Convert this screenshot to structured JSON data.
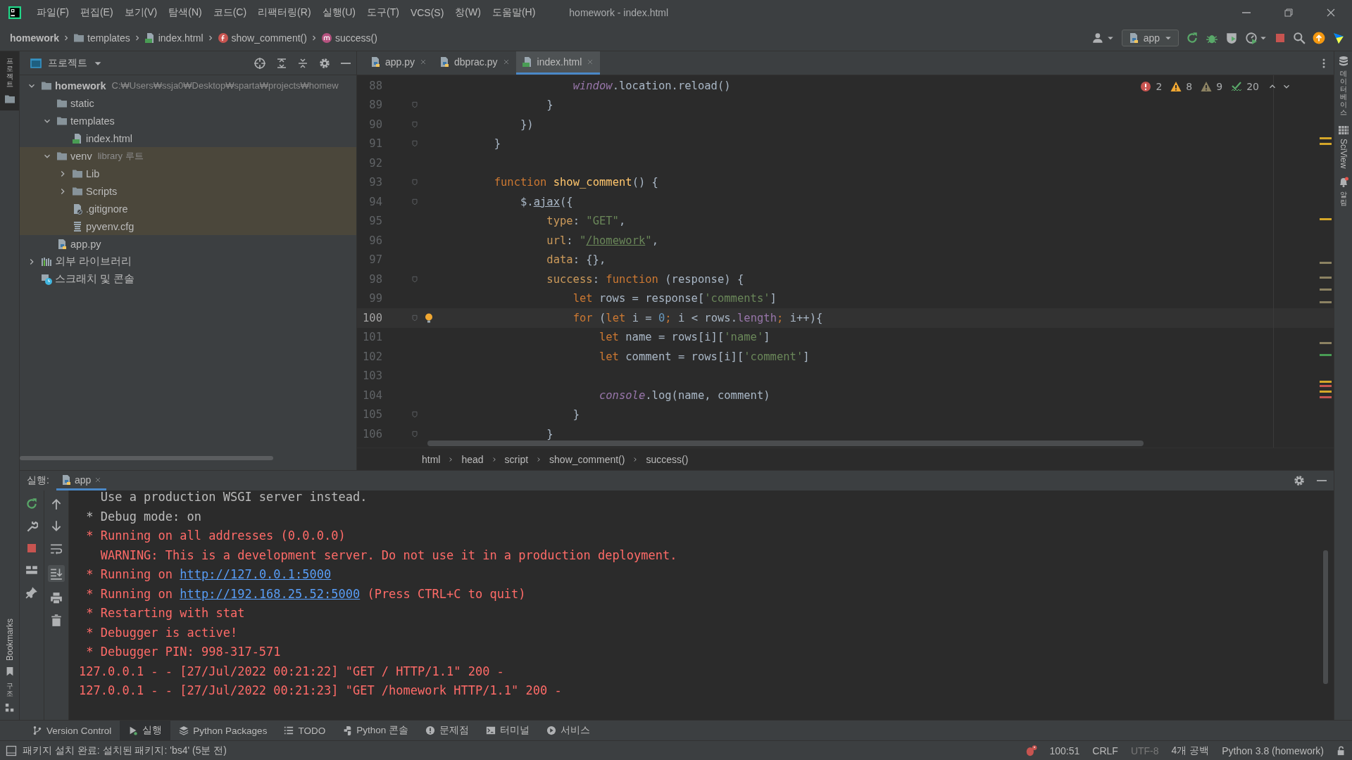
{
  "menu_bar": {
    "items": [
      "파일(F)",
      "편집(E)",
      "보기(V)",
      "탐색(N)",
      "코드(C)",
      "리팩터링(R)",
      "실행(U)",
      "도구(T)",
      "VCS(S)",
      "창(W)",
      "도움말(H)"
    ],
    "title": "homework - index.html"
  },
  "nav_bar": {
    "breadcrumbs": [
      {
        "kind": "project",
        "label": "homework"
      },
      {
        "kind": "folder",
        "label": "templates"
      },
      {
        "kind": "html",
        "label": "index.html"
      },
      {
        "kind": "function",
        "label": "show_comment()"
      },
      {
        "kind": "method",
        "label": "success()"
      }
    ],
    "run_config": "app"
  },
  "left_strip": {
    "project": "프로젝트",
    "bookmarks": "Bookmarks",
    "structure": "구조"
  },
  "project_panel": {
    "title": "프로젝트",
    "tree": [
      {
        "label": "homework",
        "kind": "project",
        "hint": "C:₩Users₩ssja0₩Desktop₩sparta₩projects₩homew",
        "expanded": true,
        "children": [
          {
            "label": "static",
            "kind": "folder"
          },
          {
            "label": "templates",
            "kind": "folder",
            "expanded": true,
            "children": [
              {
                "label": "index.html",
                "kind": "html"
              }
            ]
          },
          {
            "label": "venv",
            "kind": "folder",
            "hint": "library 루트",
            "expanded": true,
            "highlighted": true,
            "children": [
              {
                "label": "Lib",
                "kind": "folder",
                "expanded": false
              },
              {
                "label": "Scripts",
                "kind": "folder",
                "expanded": false
              },
              {
                "label": ".gitignore",
                "kind": "ignore"
              },
              {
                "label": "pyvenv.cfg",
                "kind": "config"
              }
            ]
          },
          {
            "label": "app.py",
            "kind": "python"
          }
        ]
      },
      {
        "label": "외부 라이브러리",
        "kind": "library",
        "expanded": false
      },
      {
        "label": "스크래치 및 콘솔",
        "kind": "scratch"
      }
    ]
  },
  "editor": {
    "tabs": [
      {
        "label": "app.py",
        "kind": "python",
        "selected": false
      },
      {
        "label": "dbprac.py",
        "kind": "python",
        "selected": false
      },
      {
        "label": "index.html",
        "kind": "html",
        "selected": true
      }
    ],
    "inspections": {
      "errors": "2",
      "warnings": "8",
      "weak_warnings": "9",
      "typos": "20"
    },
    "lines": [
      {
        "number": "88",
        "current": false,
        "fold": false,
        "segments": [
          {
            "kind": "global",
            "text": "                    window"
          },
          {
            "kind": "plain",
            "text": ".location.reload()"
          }
        ]
      },
      {
        "number": "89",
        "current": false,
        "fold": true,
        "segments": [
          {
            "kind": "plain",
            "text": "                }"
          }
        ]
      },
      {
        "number": "90",
        "current": false,
        "fold": true,
        "segments": [
          {
            "kind": "plain",
            "text": "            })"
          }
        ]
      },
      {
        "number": "91",
        "current": false,
        "fold": true,
        "segments": [
          {
            "kind": "plain",
            "text": "        }"
          }
        ]
      },
      {
        "number": "92",
        "current": false,
        "fold": false
      },
      {
        "number": "93",
        "current": false,
        "fold": true,
        "segments": [
          {
            "kind": "keyword",
            "text": "        function "
          },
          {
            "kind": "function",
            "text": "show_comment"
          },
          {
            "kind": "plain",
            "text": "() {"
          }
        ]
      },
      {
        "number": "94",
        "current": false,
        "fold": true,
        "segments": [
          {
            "kind": "plain",
            "text": "            $."
          },
          {
            "kind": "underlined",
            "text": "ajax"
          },
          {
            "kind": "plain",
            "text": "({"
          }
        ]
      },
      {
        "number": "95",
        "current": false,
        "fold": false,
        "segments": [
          {
            "kind": "key",
            "text": "                type"
          },
          {
            "kind": "plain",
            "text": ": "
          },
          {
            "kind": "string",
            "text": "\"GET\""
          },
          {
            "kind": "plain",
            "text": ","
          }
        ]
      },
      {
        "number": "96",
        "current": false,
        "fold": false,
        "segments": [
          {
            "kind": "key",
            "text": "                url"
          },
          {
            "kind": "plain",
            "text": ": "
          },
          {
            "kind": "string",
            "text": "\""
          },
          {
            "kind": "link",
            "text": "/homework"
          },
          {
            "kind": "string",
            "text": "\""
          },
          {
            "kind": "plain",
            "text": ","
          }
        ]
      },
      {
        "number": "97",
        "current": false,
        "fold": false,
        "segments": [
          {
            "kind": "key",
            "text": "                data"
          },
          {
            "kind": "plain",
            "text": ": {},"
          }
        ]
      },
      {
        "number": "98",
        "current": false,
        "fold": true,
        "segments": [
          {
            "kind": "key",
            "text": "                success"
          },
          {
            "kind": "plain",
            "text": ": "
          },
          {
            "kind": "keyword",
            "text": "function"
          },
          {
            "kind": "plain",
            "text": " (response) {"
          }
        ]
      },
      {
        "number": "99",
        "current": false,
        "fold": false,
        "segments": [
          {
            "kind": "keyword",
            "text": "                    let"
          },
          {
            "kind": "plain",
            "text": " rows = response["
          },
          {
            "kind": "string",
            "text": "'comments'"
          },
          {
            "kind": "plain",
            "text": "]"
          }
        ]
      },
      {
        "number": "100",
        "current": true,
        "fold": true,
        "segments": [
          {
            "kind": "keyword",
            "text": "                    for"
          },
          {
            "kind": "plain",
            "text": " ("
          },
          {
            "kind": "keyword",
            "text": "let"
          },
          {
            "kind": "plain",
            "text": " i = "
          },
          {
            "kind": "number",
            "text": "0"
          },
          {
            "kind": "keyword",
            "text": ";"
          },
          {
            "kind": "plain",
            "text": " i < rows."
          },
          {
            "kind": "property",
            "text": "length"
          },
          {
            "kind": "keyword",
            "text": ";"
          },
          {
            "kind": "plain",
            "text": " i++){"
          }
        ]
      },
      {
        "number": "101",
        "current": false,
        "fold": false,
        "segments": [
          {
            "kind": "keyword",
            "text": "                        let"
          },
          {
            "kind": "plain",
            "text": " name = rows[i]["
          },
          {
            "kind": "string",
            "text": "'name'"
          },
          {
            "kind": "plain",
            "text": "]"
          }
        ]
      },
      {
        "number": "102",
        "current": false,
        "fold": false,
        "segments": [
          {
            "kind": "keyword",
            "text": "                        let"
          },
          {
            "kind": "plain",
            "text": " comment = rows[i]["
          },
          {
            "kind": "string",
            "text": "'comment'"
          },
          {
            "kind": "plain",
            "text": "]"
          }
        ]
      },
      {
        "number": "103",
        "current": false,
        "fold": false
      },
      {
        "number": "104",
        "current": false,
        "fold": false,
        "segments": [
          {
            "kind": "global",
            "text": "                        console"
          },
          {
            "kind": "plain",
            "text": ".log(name, comment)"
          }
        ]
      },
      {
        "number": "105",
        "current": false,
        "fold": true,
        "segments": [
          {
            "kind": "plain",
            "text": "                    }"
          }
        ]
      },
      {
        "number": "106",
        "current": false,
        "fold": true,
        "segments": [
          {
            "kind": "plain",
            "text": "                }"
          }
        ]
      }
    ],
    "breadcrumbs": [
      "html",
      "head",
      "script",
      "show_comment()",
      "success()"
    ]
  },
  "right_strip": [
    {
      "kind": "database",
      "label": "데이터베이스"
    },
    {
      "kind": "sciview",
      "label": "SciView"
    },
    {
      "kind": "notifications",
      "label": "알림"
    }
  ],
  "run_panel": {
    "label": "실행:",
    "tab": "app",
    "lines": [
      {
        "segments": [
          {
            "kind": "normal",
            "text": "   Use a production WSGI server instead."
          }
        ]
      },
      {
        "segments": [
          {
            "kind": "normal",
            "text": " * Debug mode: on"
          }
        ]
      },
      {
        "segments": [
          {
            "kind": "error",
            "text": " * Running on all addresses (0.0.0.0)"
          }
        ]
      },
      {
        "segments": [
          {
            "kind": "error",
            "text": "   WARNING: This is a development server. Do not use it in a production deployment."
          }
        ]
      },
      {
        "segments": [
          {
            "kind": "error",
            "text": " * Running on "
          },
          {
            "kind": "link",
            "text": "http://127.0.0.1:5000"
          }
        ]
      },
      {
        "segments": [
          {
            "kind": "error",
            "text": " * Running on "
          },
          {
            "kind": "link",
            "text": "http://192.168.25.52:5000"
          },
          {
            "kind": "error",
            "text": " (Press CTRL+C to quit)"
          }
        ]
      },
      {
        "segments": [
          {
            "kind": "error",
            "text": " * Restarting with stat"
          }
        ]
      },
      {
        "segments": [
          {
            "kind": "error",
            "text": " * Debugger is active!"
          }
        ]
      },
      {
        "segments": [
          {
            "kind": "error",
            "text": " * Debugger PIN: 998-317-571"
          }
        ]
      },
      {
        "segments": [
          {
            "kind": "error",
            "text": "127.0.0.1 - - [27/Jul/2022 00:21:22] \"GET / HTTP/1.1\" 200 -"
          }
        ]
      },
      {
        "segments": [
          {
            "kind": "error",
            "text": "127.0.0.1 - - [27/Jul/2022 00:21:23] \"GET /homework HTTP/1.1\" 200 -"
          }
        ]
      }
    ]
  },
  "tool_tabs": [
    {
      "kind": "vcs",
      "label": "Version Control",
      "selected": false
    },
    {
      "kind": "run",
      "label": "실행",
      "selected": true
    },
    {
      "kind": "packages",
      "label": "Python Packages",
      "selected": false
    },
    {
      "kind": "todo",
      "label": "TODO",
      "selected": false
    },
    {
      "kind": "console",
      "label": "Python 콘솔",
      "selected": false
    },
    {
      "kind": "problems",
      "label": "문제점",
      "selected": false
    },
    {
      "kind": "terminal",
      "label": "터미널",
      "selected": false
    },
    {
      "kind": "services",
      "label": "서비스",
      "selected": false
    }
  ],
  "status_bar": {
    "message": "패키지 설치 완료: 설치된 패키지: 'bs4' (5분 전)",
    "position": "100:51",
    "line_separator": "CRLF",
    "encoding": "UTF-8",
    "indent": "4개 공백",
    "interpreter": "Python 3.8 (homework)"
  }
}
